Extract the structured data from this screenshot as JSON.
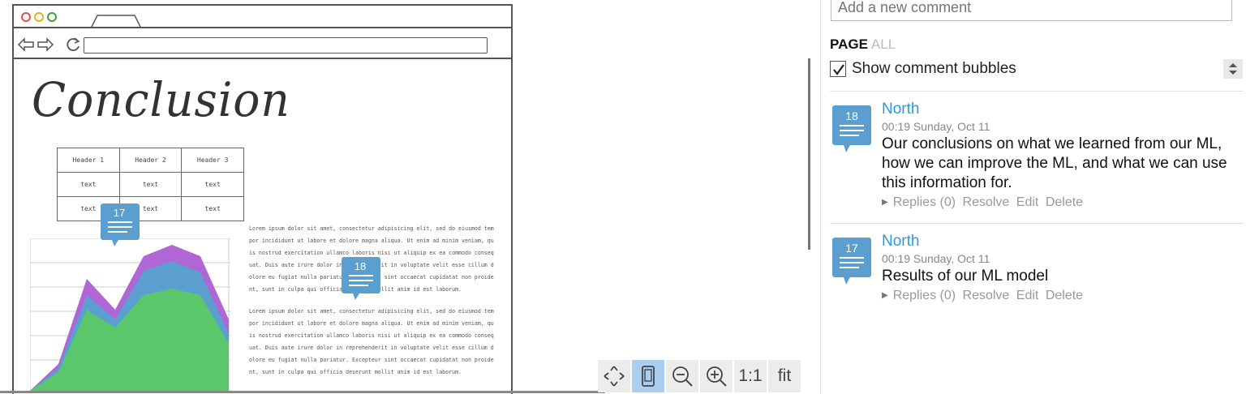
{
  "canvas": {
    "heading": "Conclusion",
    "table": {
      "headers": [
        "Header 1",
        "Header 2",
        "Header 3"
      ],
      "rows": [
        [
          "text",
          "text",
          "text"
        ],
        [
          "text",
          "text",
          "text"
        ]
      ]
    },
    "paragraph_1": "Lorem ipsum dolor sit amet, consectetur adipisicing elit, sed do eiusmod tempor incididunt ut labore et dolore magna aliqua. Ut enim ad minim veniam, quis nostrud exercitation ullamco laboris nisi ut aliquip ex ea commodo consequat. Duis aute irure dolor in reprehenderit in voluptate velit esse cillum dolore eu fugiat nulla pariatur. Excepteur sint occaecat cupidatat non proident, sunt in culpa qui officia deserunt mollit anim id est laborum.",
    "paragraph_2": "Lorem ipsum dolor sit amet, consectetur adipisicing elit, sed do eiusmod tempor incididunt ut labore et dolore magna aliqua. Ut enim ad minim veniam, quis nostrud exercitation ullamco laboris nisi ut aliquip ex ea commodo consequat. Duis aute irure dolor in reprehenderit in voluptate velit esse cillum dolore eu fugiat nulla pariatur. Excepteur sint occaecat cupidatat non proident, sunt in culpa qui officia deserunt mollit anim id est laborum.",
    "bubbles": [
      {
        "number": "17"
      },
      {
        "number": "18"
      }
    ],
    "area_chart": {
      "colors": [
        "#5bc76b",
        "#5b9fd0",
        "#b066d4"
      ]
    }
  },
  "toolbar": {
    "move_icon": "move-icon",
    "device_icon": "device-icon",
    "zoom_out_icon": "zoom-out-icon",
    "zoom_in_icon": "zoom-in-icon",
    "actual_size_label": "1:1",
    "fit_label": "fit"
  },
  "panel": {
    "comment_placeholder": "Add a new comment",
    "filter_page": "PAGE",
    "filter_all": "ALL",
    "show_bubbles_label": "Show comment bubbles",
    "show_bubbles_checked": true,
    "comments": [
      {
        "number": "18",
        "author": "North",
        "time": "00:19 Sunday, Oct 11",
        "text": "Our conclusions on what we learned from our ML, how we can improve the ML, and what we can use this information for.",
        "replies": "Replies (0)",
        "resolve": "Resolve",
        "edit": "Edit",
        "delete": "Delete"
      },
      {
        "number": "17",
        "author": "North",
        "time": "00:19 Sunday, Oct 11",
        "text": "Results of our ML model",
        "replies": "Replies (0)",
        "resolve": "Resolve",
        "edit": "Edit",
        "delete": "Delete"
      }
    ]
  },
  "colors": {
    "accent": "#2a9bd8",
    "bubble": "#5b9fd0",
    "toolbar_active": "#a8cff0"
  }
}
